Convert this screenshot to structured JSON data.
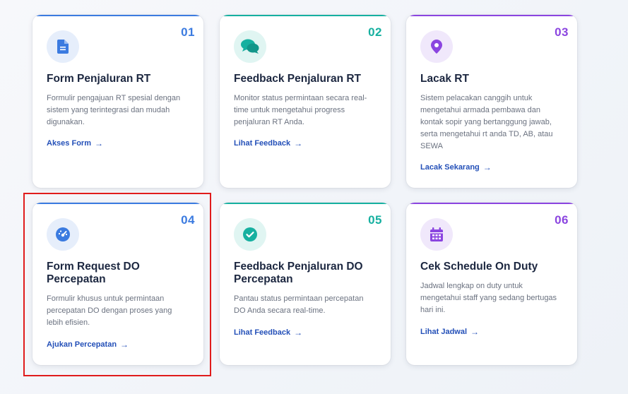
{
  "cards": [
    {
      "number": "01",
      "title": "Form Penjaluran RT",
      "description": "Formulir pengajuan RT spesial dengan sistem yang terintegrasi dan mudah digunakan.",
      "link": "Akses Form",
      "icon": "document-icon",
      "accent": "#3b7be0"
    },
    {
      "number": "02",
      "title": "Feedback Penjaluran RT",
      "description": "Monitor status permintaan secara real-time untuk mengetahui progress penjaluran RT Anda.",
      "link": "Lihat Feedback",
      "icon": "chat-bubbles-icon",
      "accent": "#16b0a0"
    },
    {
      "number": "03",
      "title": "Lacak RT",
      "description": "Sistem pelacakan canggih untuk mengetahui armada pembawa dan kontak sopir yang bertanggung jawab, serta mengetahui rt anda TD, AB, atau SEWA",
      "link": "Lacak Sekarang",
      "icon": "map-pin-icon",
      "accent": "#8b45e0"
    },
    {
      "number": "04",
      "title": "Form Request DO Percepatan",
      "description": "Formulir khusus untuk permintaan percepatan DO dengan proses yang lebih efisien.",
      "link": "Ajukan Percepatan",
      "icon": "speedometer-icon",
      "accent": "#3b7be0"
    },
    {
      "number": "05",
      "title": "Feedback Penjaluran DO Percepatan",
      "description": "Pantau status permintaan percepatan DO Anda secara real-time.",
      "link": "Lihat Feedback",
      "icon": "check-circle-icon",
      "accent": "#16b0a0"
    },
    {
      "number": "06",
      "title": "Cek Schedule On Duty",
      "description": "Jadwal lengkap on duty untuk mengetahui staff yang sedang bertugas hari ini.",
      "link": "Lihat Jadwal",
      "icon": "calendar-icon",
      "accent": "#8b45e0"
    }
  ],
  "arrow": "→"
}
